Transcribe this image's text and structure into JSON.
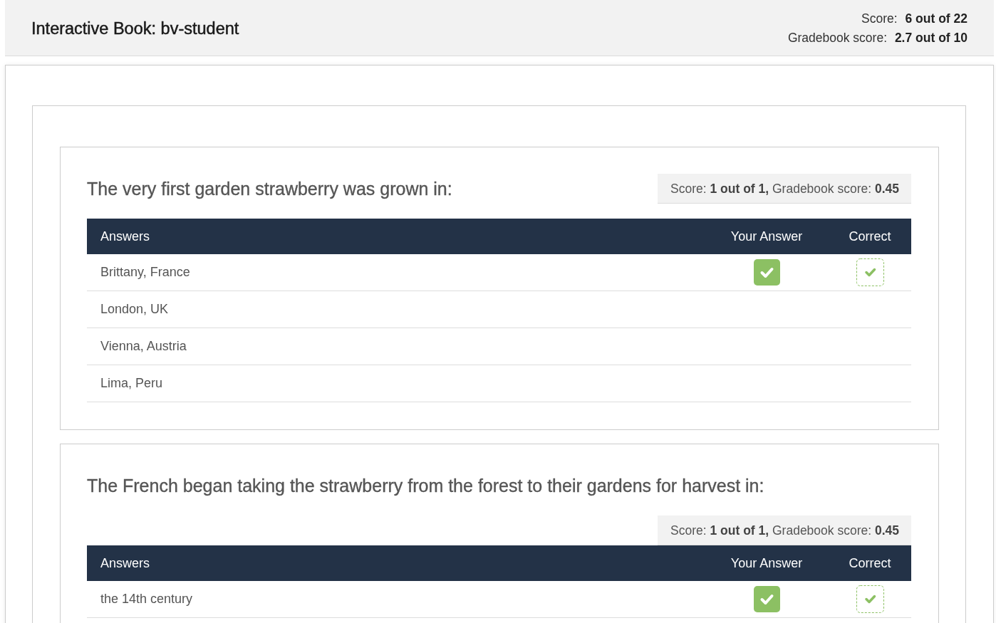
{
  "header": {
    "title": "Interactive Book: bv-student",
    "score": "Score: **6 out of 22**",
    "gradebook_score": "Gradebook score: **2.7 out of 10**"
  },
  "questions": [
    {
      "title": "The very first garden strawberry was grown in:",
      "score_summary": "Score: **1 out of 1,** Gradebook score: **0.45**",
      "columns": [
        "Answers",
        "Your Answer",
        "Correct"
      ],
      "answers": [
        {
          "text": "Brittany, France",
          "your_answer": true,
          "correct": true
        },
        {
          "text": "London, UK",
          "your_answer": false,
          "correct": false
        },
        {
          "text": "Vienna, Austria",
          "your_answer": false,
          "correct": false
        },
        {
          "text": "Lima, Peru",
          "your_answer": false,
          "correct": false
        }
      ]
    },
    {
      "title": "The French began taking the strawberry from the forest to their gardens for harvest in:",
      "score_summary": "Score: **1 out of 1,** Gradebook score: **0.45**",
      "columns": [
        "Answers",
        "Your Answer",
        "Correct"
      ],
      "answers": [
        {
          "text": "the 14th century",
          "your_answer": true,
          "correct": true
        }
      ]
    }
  ]
}
